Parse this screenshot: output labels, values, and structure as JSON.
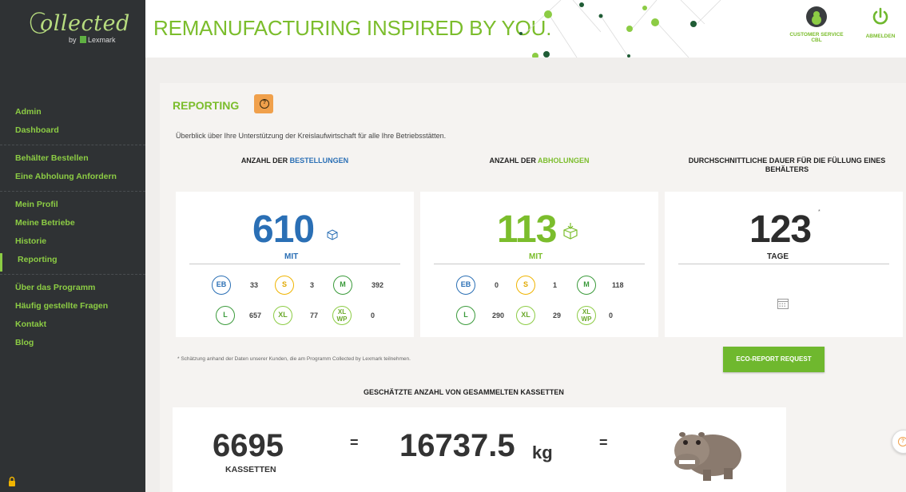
{
  "brand": {
    "script_name": "ollected",
    "by_text": "by",
    "lexmark": "Lexmark",
    "accent": "#7bbd2c"
  },
  "header": {
    "headline": "REMANUFACTURING INSPIRED BY YOU.",
    "customer_service": "CUSTOMER SERVICE",
    "customer_service_sub": "CBL",
    "logout": "ABMELDEN"
  },
  "sidebar": {
    "group1": [
      "Admin",
      "Dashboard"
    ],
    "group2": [
      "Behälter Bestellen",
      "Eine Abholung Anfordern"
    ],
    "group3": [
      "Mein Profil",
      "Meine Betriebe",
      "Historie",
      "Reporting"
    ],
    "group4": [
      "Über das Programm",
      "Häufig gestellte Fragen",
      "Kontakt",
      "Blog"
    ],
    "active": "Reporting"
  },
  "reporting": {
    "title": "REPORTING",
    "intro": "Überblick über Ihre Unterstützung der Kreislaufwirtschaft für alle Ihre Betriebsstätten.",
    "col1_prefix": "ANZAHL DER ",
    "col1_highlight": "BESTELLUNGEN",
    "col2_prefix": "ANZAHL DER ",
    "col2_highlight": "ABHOLUNGEN",
    "col3_title": "DURCHSCHNITTLICHE DAUER FÜR DIE FÜLLUNG EINES BEHÄLTERS",
    "orders": {
      "total": "610",
      "unit": "MIT",
      "sizes": [
        {
          "label": "EB",
          "count": "33"
        },
        {
          "label": "S",
          "count": "3"
        },
        {
          "label": "M",
          "count": "392"
        },
        {
          "label": "L",
          "count": "657"
        },
        {
          "label": "XL",
          "count": "77"
        },
        {
          "label_top": "XL",
          "label_bottom": "WP",
          "count": "0"
        }
      ]
    },
    "pickups": {
      "total": "113",
      "unit": "MIT",
      "sizes": [
        {
          "label": "EB",
          "count": "0"
        },
        {
          "label": "S",
          "count": "1"
        },
        {
          "label": "M",
          "count": "118"
        },
        {
          "label": "L",
          "count": "290"
        },
        {
          "label": "XL",
          "count": "29"
        },
        {
          "label_top": "XL",
          "label_bottom": "WP",
          "count": "0"
        }
      ]
    },
    "duration": {
      "value": "123",
      "asterisk": "*",
      "unit": "TAGE"
    },
    "footnote": "* Schätzung anhand der Daten unserer Kunden, die am Programm Collected by Lexmark teilnehmen.",
    "eco_button": "ECO-REPORT REQUEST",
    "estimate_title": "GESCHÄTZTE ANZAHL VON GESAMMELTEN KASSETTEN",
    "cartridges": "6695",
    "cartridges_unit": "KASSETTEN",
    "equals": "=",
    "weight": "16737.5",
    "weight_unit": "kg",
    "equals2": "="
  }
}
